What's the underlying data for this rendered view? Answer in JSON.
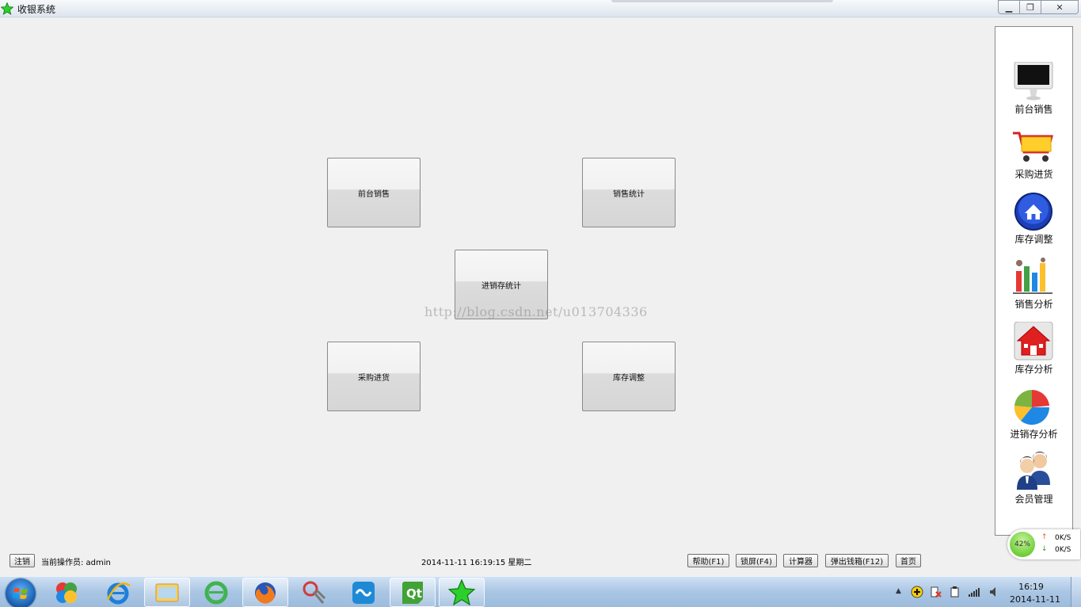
{
  "window": {
    "title": "收银系统",
    "icon": "green-star-icon"
  },
  "tiles": {
    "front_sales": "前台销售",
    "sales_stats": "销售统计",
    "inventory_stats": "进销存统计",
    "purchase": "采购进货",
    "stock_adjust": "库存调整"
  },
  "watermark": "http://blog.csdn.net/u013704336",
  "sidebar": {
    "items": [
      {
        "label": "前台销售",
        "icon": "monitor-icon"
      },
      {
        "label": "采购进货",
        "icon": "shopping-cart-icon"
      },
      {
        "label": "库存调整",
        "icon": "home-icon"
      },
      {
        "label": "销售分析",
        "icon": "bar-chart-icon"
      },
      {
        "label": "库存分析",
        "icon": "red-house-icon"
      },
      {
        "label": "进销存分析",
        "icon": "pie-chart-icon"
      },
      {
        "label": "会员管理",
        "icon": "users-icon"
      }
    ]
  },
  "status": {
    "logout": "注销",
    "operator": "当前操作员: admin",
    "datetime": "2014-11-11 16:19:15 星期二",
    "help": "帮助(F1)",
    "lock": "锁屏(F4)",
    "calculator": "计算器",
    "open_drawer": "弹出钱箱(F12)",
    "home": "首页"
  },
  "netwidget": {
    "percent": "42%",
    "up": "0K/S",
    "down": "0K/S"
  },
  "taskbar": {
    "apps": [
      "cloud-app-icon",
      "internet-explorer-icon",
      "file-explorer-icon",
      "ie-green-icon",
      "firefox-icon",
      "snipping-tool-icon",
      "sync-app-icon",
      "qt-creator-icon",
      "cash-register-app-icon"
    ],
    "time": "16:19",
    "date": "2014-11-11"
  },
  "colors": {
    "accent": "#1c9c1c",
    "taskbar": "#a9c6e4"
  }
}
